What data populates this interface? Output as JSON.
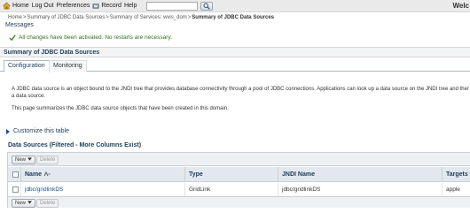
{
  "toolbar": {
    "home": "Home",
    "logout": "Log Out",
    "preferences": "Preferences",
    "record": "Record",
    "help": "Help",
    "search_value": "",
    "welcome": "Welc"
  },
  "breadcrumb": {
    "items": [
      "Home",
      "Summary of JDBC Data Sources",
      "Summary of Services: wvis_dom"
    ],
    "separator": ">",
    "current": "Summary of JDBC Data Sources"
  },
  "messages": {
    "title": "Messages",
    "success_text": "All changes have been activated. No restarts are necessary."
  },
  "section": {
    "title": "Summary of JDBC Data Sources"
  },
  "tabs": [
    {
      "label": "Configuration",
      "active": true
    },
    {
      "label": "Monitoring",
      "active": false
    }
  ],
  "description": {
    "line1": "A JDBC data source is an object bound to the JNDI tree that provides database connectivity through a pool of JDBC connections. Applications can look up a data source on the JNDI tree and ther",
    "line2": "a data source.",
    "line3": "This page summarizes the JDBC data source objects that have been created in this domain."
  },
  "customize_link": "Customize this table",
  "table": {
    "caption": "Data Sources (Filtered - More Columns Exist)",
    "new_button": "New",
    "delete_button": "Delete",
    "columns": [
      "Name",
      "Type",
      "JNDI Name",
      "Targets"
    ],
    "rows": [
      {
        "name": "jdbc/gridlinkDS",
        "type": "GridLink",
        "jndi": "jdbc/gridlinkDS",
        "targets": "apple"
      }
    ]
  },
  "colors": {
    "header_blue": "#1b3c5a",
    "success_green": "#3a6b20",
    "link_blue": "#1b4f86"
  }
}
